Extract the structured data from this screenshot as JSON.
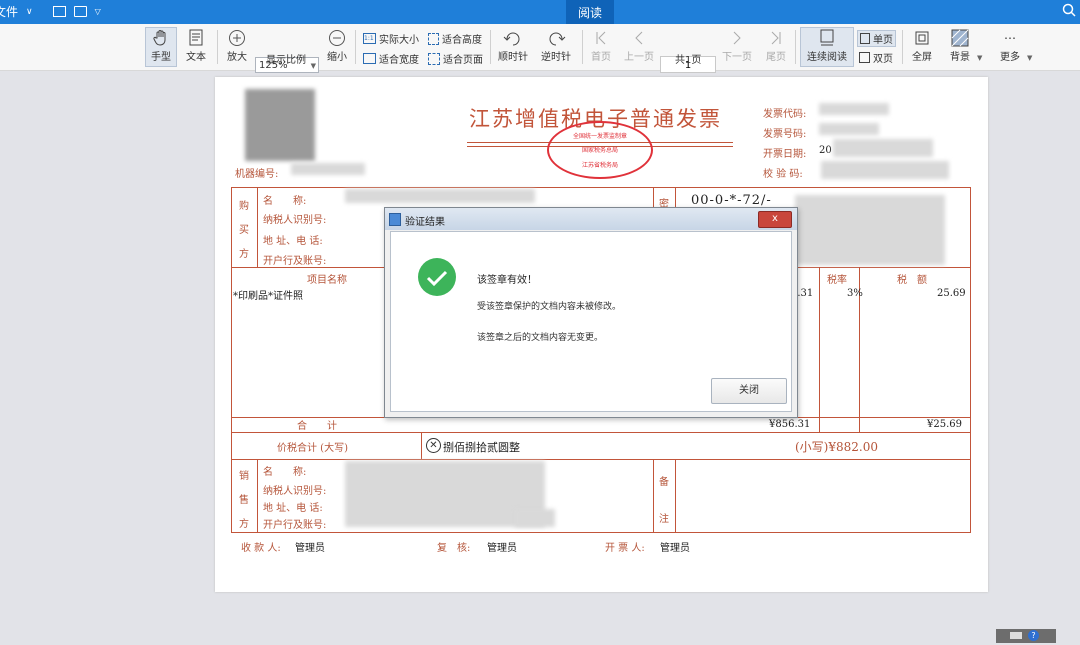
{
  "titlebar": {
    "file_menu": "文件",
    "mode_tab": "阅读"
  },
  "toolbar": {
    "hand": "手型",
    "text": "文本",
    "zoom_in": "放大",
    "zoom_value": "125%",
    "display_ratio": "显示比例",
    "zoom_out": "缩小",
    "actual_size": "实际大小",
    "fit_height": "适合高度",
    "fit_width": "适合宽度",
    "fit_page": "适合页面",
    "rotate_cw": "顺时针",
    "rotate_ccw": "逆时针",
    "first_page": "首页",
    "prev_page": "上一页",
    "page_input": "1",
    "total_pages": "共1页",
    "next_page": "下一页",
    "last_page": "尾页",
    "continuous": "连续阅读",
    "single": "单页",
    "double": "双页",
    "fullscreen": "全屏",
    "background": "背景",
    "more": "更多"
  },
  "invoice": {
    "title": "江苏增值税电子普通发票",
    "seal_text": {
      "top": "全国统一发票监制章",
      "middle": "国家税务总局",
      "bottom": "江苏省税务局"
    },
    "code_label": "发票代码:",
    "number_label": "发票号码:",
    "date_label": "开票日期:",
    "date_prefix": "20",
    "check_label": "校 验 码:",
    "machine_label": "机器编号:",
    "buyer_side": [
      "购",
      "买",
      "方"
    ],
    "buyer_fields": [
      "名　　称:",
      "纳税人识别号:",
      "地 址、电 话:",
      "开户行及账号:"
    ],
    "password_label": "密",
    "password_text": "00-0-*-72/-",
    "item_header": "项目名称",
    "tax_rate_header": "税率",
    "tax_amount_header": "税　额",
    "item_name": "*印刷品*证件照",
    "amount_partial": "5.31",
    "tax_rate": "3%",
    "tax_amount": "25.69",
    "subtotal_label": "合　　计",
    "subtotal_amount": "¥856.31",
    "subtotal_tax": "¥25.69",
    "total_label": "价税合计 (大写)",
    "total_upper": "捌佰捌拾贰圆整",
    "total_lower": "(小写)¥882.00",
    "seller_side": [
      "销",
      "售",
      "方"
    ],
    "seller_fields": [
      "名　　称:",
      "纳税人识别号:",
      "地 址、电 话:",
      "开户行及账号:"
    ],
    "remark_label": [
      "备",
      "注"
    ],
    "payee_label": "收 款 人:",
    "payee": "管理员",
    "reviewer_label": "复　核:",
    "reviewer": "管理员",
    "issuer_label": "开 票 人:",
    "issuer": "管理员"
  },
  "dialog": {
    "title": "验证结果",
    "close_x": "x",
    "heading": "该签章有效！",
    "line1": "受该签章保护的文档内容未被修改。",
    "line2": "该签章之后的文档内容无变更。",
    "close_button": "关闭"
  },
  "colors": {
    "accent": "#1f7fd9",
    "invoice_red": "#c2553a",
    "seal_red": "#e0323a",
    "success_green": "#3db45a"
  }
}
